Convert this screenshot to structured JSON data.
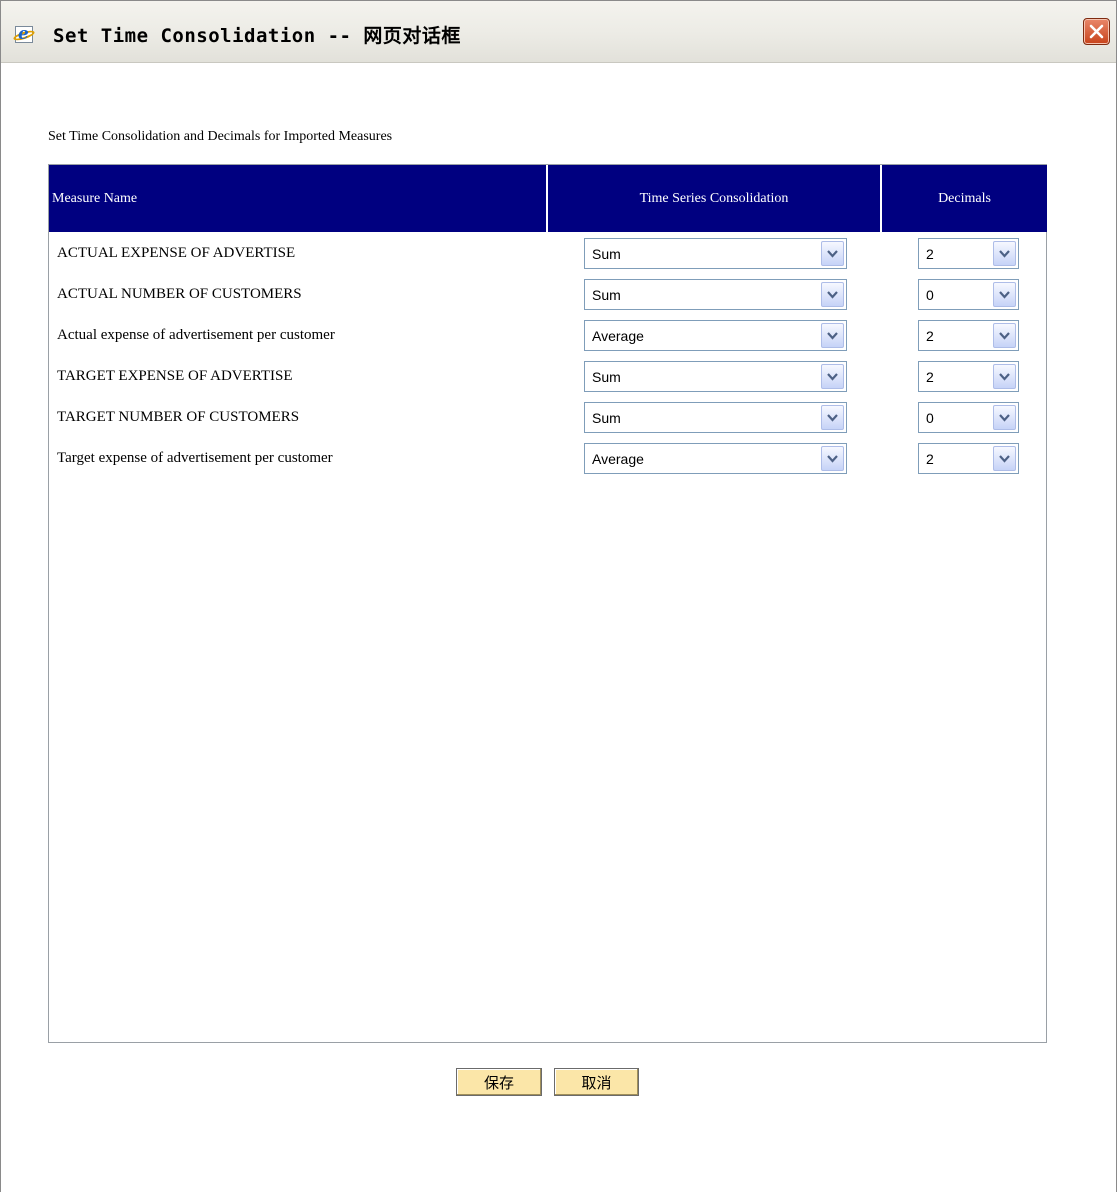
{
  "window": {
    "title": "Set Time Consolidation -- 网页对话框",
    "icon": "ie-icon",
    "close_icon": "close-icon"
  },
  "page": {
    "heading": "Set Time Consolidation and Decimals for Imported Measures"
  },
  "table": {
    "headers": {
      "measure_name": "Measure Name",
      "consolidation": "Time Series Consolidation",
      "decimals": "Decimals"
    },
    "rows": [
      {
        "name": "ACTUAL EXPENSE OF ADVERTISE",
        "consolidation": "Sum",
        "decimals": "2"
      },
      {
        "name": "ACTUAL NUMBER OF CUSTOMERS",
        "consolidation": "Sum",
        "decimals": "0"
      },
      {
        "name": "Actual expense of advertisement per customer",
        "consolidation": "Average",
        "decimals": "2"
      },
      {
        "name": "TARGET EXPENSE OF ADVERTISE",
        "consolidation": "Sum",
        "decimals": "2"
      },
      {
        "name": "TARGET NUMBER OF CUSTOMERS",
        "consolidation": "Sum",
        "decimals": "0"
      },
      {
        "name": "Target expense of advertisement per customer",
        "consolidation": "Average",
        "decimals": "2"
      }
    ]
  },
  "buttons": {
    "save_label": "保存",
    "cancel_label": "取消"
  },
  "colors": {
    "header_bg": "#000080",
    "button_bg": "#fbe6a8",
    "close_button": "#d4542a"
  }
}
